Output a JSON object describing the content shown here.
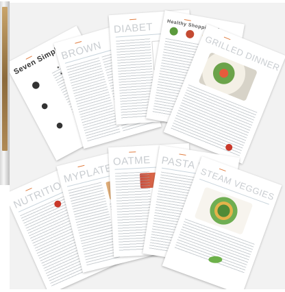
{
  "row_top": [
    {
      "id": "steps",
      "title": "Seven Simple St"
    },
    {
      "id": "brownies",
      "title": "BROWN"
    },
    {
      "id": "diabetes",
      "title": "DIABET"
    },
    {
      "id": "shopping",
      "title": "Healthy Shopping Li"
    },
    {
      "id": "grilled",
      "title": "GRILLED DINNER"
    }
  ],
  "row_bottom": [
    {
      "id": "nutrition",
      "title": "NUTRITIO"
    },
    {
      "id": "myplate",
      "title": "MYPLATE"
    },
    {
      "id": "oatmeal",
      "title": "OATME"
    },
    {
      "id": "pasta",
      "title": "PASTA DIS"
    },
    {
      "id": "steam",
      "title": "STEAM VEGGIES"
    }
  ]
}
